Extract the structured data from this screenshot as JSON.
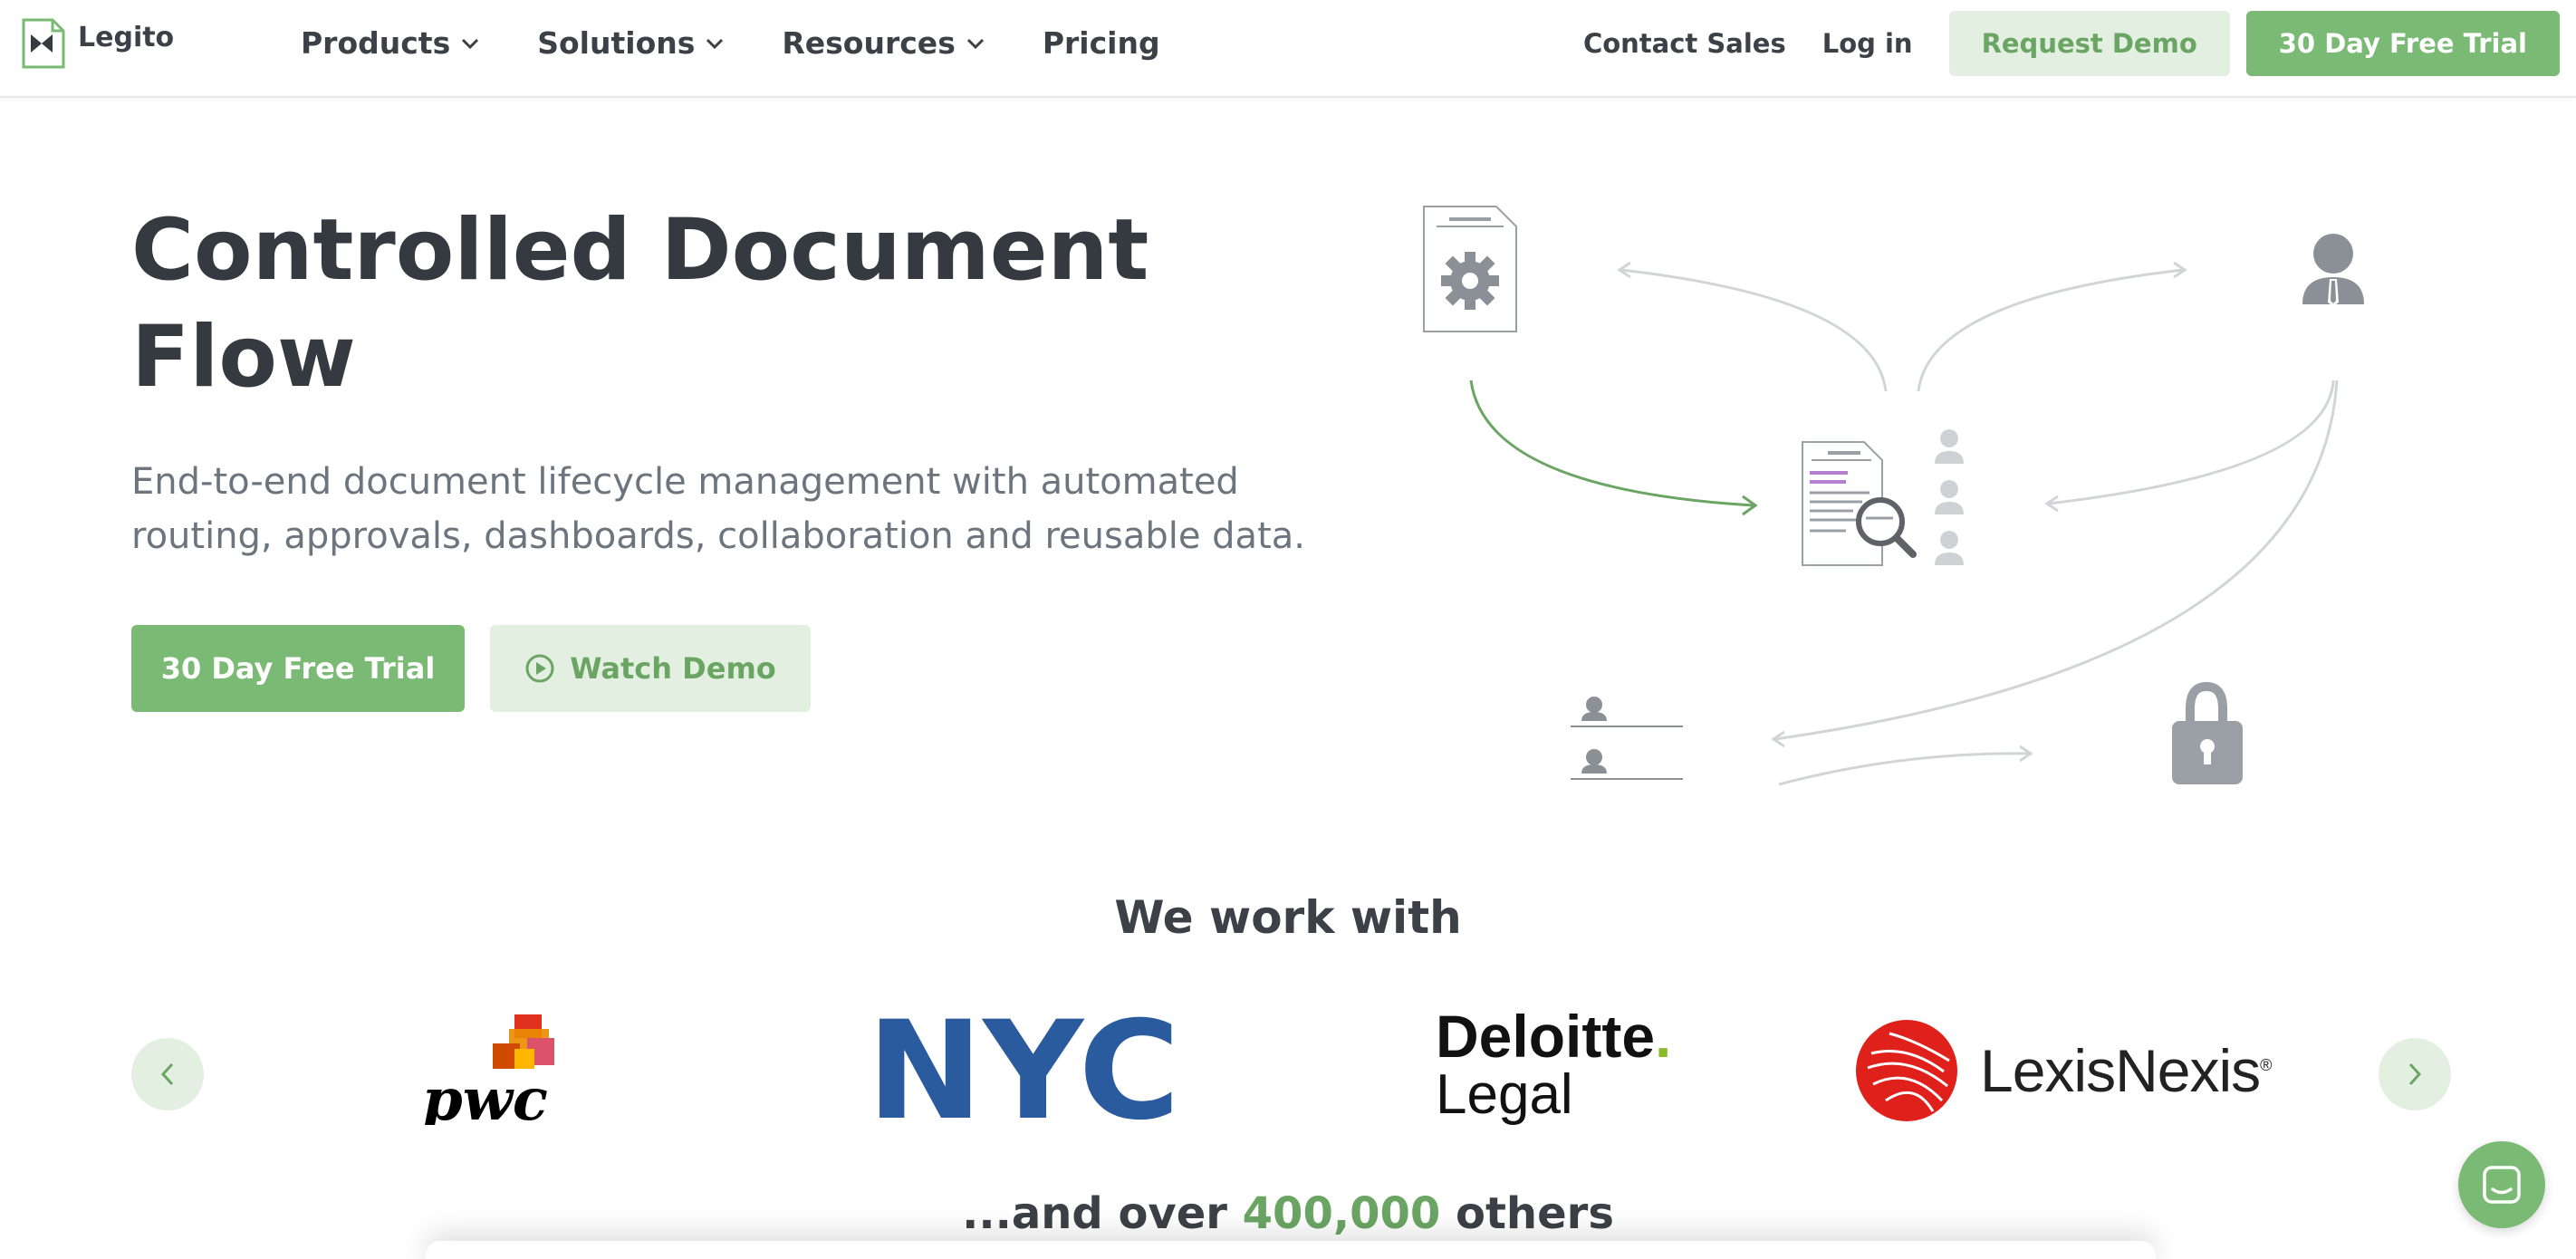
{
  "brand": {
    "name": "Legito",
    "accent": "#7aba74",
    "accent_light": "#e3efe1"
  },
  "nav": {
    "items": [
      {
        "label": "Products",
        "has_dropdown": true
      },
      {
        "label": "Solutions",
        "has_dropdown": true
      },
      {
        "label": "Resources",
        "has_dropdown": true
      },
      {
        "label": "Pricing",
        "has_dropdown": false
      }
    ],
    "contact_sales": "Contact Sales",
    "login": "Log in",
    "request_demo": "Request Demo",
    "free_trial": "30 Day Free Trial"
  },
  "hero": {
    "title_line1": "Controlled Document",
    "title_line2": "Flow",
    "subtitle_line1": "End-to-end document lifecycle management with automated",
    "subtitle_line2": "routing, approvals, dashboards, collaboration and reusable data.",
    "primary_cta": "30 Day Free Trial",
    "secondary_cta": "Watch Demo",
    "diagram_icons": [
      "settings-document-icon",
      "user-icon",
      "document-search-icon",
      "users-list-icon",
      "lock-icon"
    ]
  },
  "partners": {
    "heading": "We work with",
    "logos": [
      {
        "name": "pwc",
        "label": "pwc"
      },
      {
        "name": "nyc",
        "label": "NYC"
      },
      {
        "name": "deloitte",
        "label_line1": "Deloitte",
        "label_line2": "Legal"
      },
      {
        "name": "lexisnexis",
        "label": "LexisNexis"
      }
    ],
    "others_prefix": "...and over ",
    "others_count": "400,000",
    "others_suffix": " others"
  }
}
